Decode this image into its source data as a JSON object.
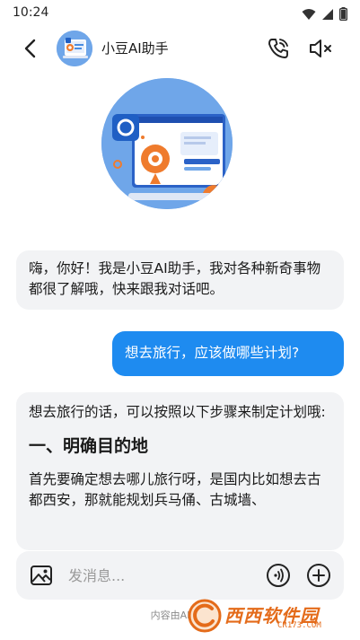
{
  "status_bar": {
    "time": "10:24",
    "icons": [
      "wifi-icon",
      "signal-icon",
      "battery-icon"
    ]
  },
  "header": {
    "title": "小豆AI助手",
    "icons": [
      "back-arrow-icon",
      "phone-call-icon",
      "speaker-mute-icon"
    ]
  },
  "messages": [
    {
      "role": "assistant",
      "text": "嗨，你好！我是小豆AI助手，我对各种新奇事物都很了解哦，快来跟我对话吧。"
    },
    {
      "role": "user",
      "text": "想去旅行，应该做哪些计划?"
    },
    {
      "role": "assistant",
      "intro": "想去旅行的话，可以按照以下步骤来制定计划哦:",
      "heading": "一、明确目的地",
      "body": "首先要确定想去哪儿旅行呀，是国内比如想去古都西安，那就能规划兵马俑、古城墙、"
    }
  ],
  "composer": {
    "placeholder": "发消息...",
    "icons": [
      "image-icon",
      "voice-wave-icon",
      "plus-circle-icon"
    ]
  },
  "disclaimer": "内容由AI生成",
  "watermark": {
    "text": "西西软件园",
    "url": "CR173.COM"
  },
  "colors": {
    "accent": "#1e8bf0",
    "bubble_gray": "#f2f3f5",
    "avatar_bg": "#6fa6e9",
    "watermark_orange": "#e46b1a"
  }
}
